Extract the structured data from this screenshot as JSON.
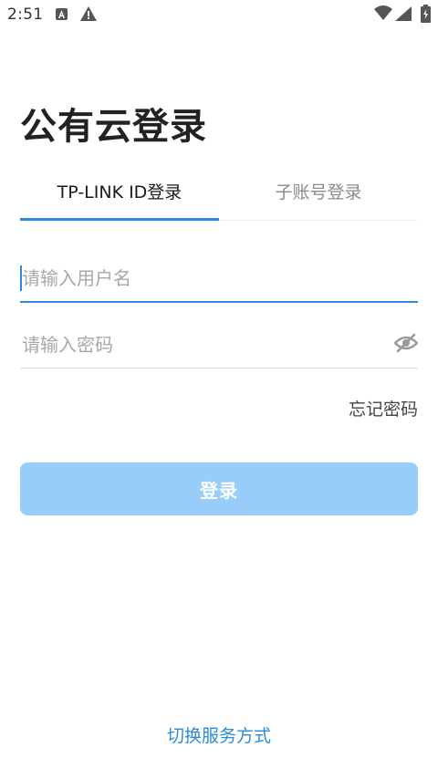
{
  "status_bar": {
    "time": "2:51",
    "icons": [
      "a-icon",
      "warning-icon",
      "wifi-icon",
      "signal-icon",
      "battery-charging-icon"
    ]
  },
  "page": {
    "title": "公有云登录"
  },
  "tabs": [
    {
      "label": "TP-LINK ID登录",
      "active": true
    },
    {
      "label": "子账号登录",
      "active": false
    }
  ],
  "form": {
    "username_placeholder": "请输入用户名",
    "username_value": "",
    "password_placeholder": "请输入密码",
    "password_value": "",
    "forgot_password": "忘记密码",
    "login_button": "登录"
  },
  "footer": {
    "switch_service": "切换服务方式"
  },
  "colors": {
    "accent": "#2b8bdc",
    "button_disabled": "#99cdf9",
    "placeholder": "#a8a8a8"
  }
}
